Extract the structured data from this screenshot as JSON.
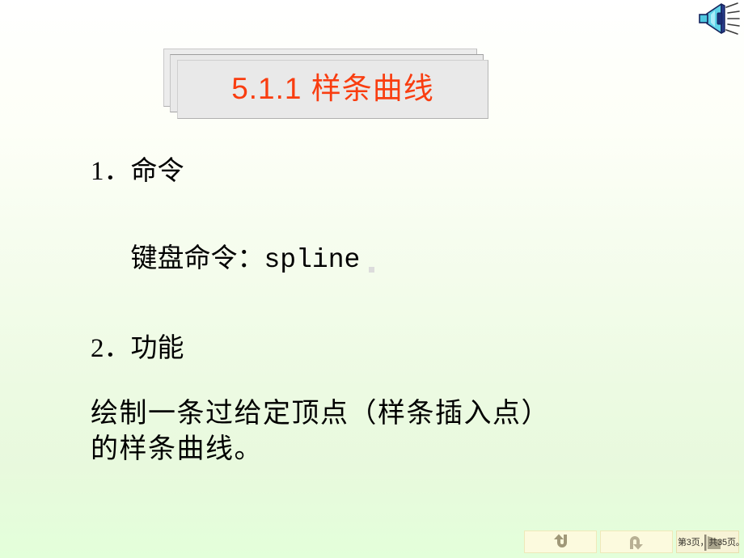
{
  "slide": {
    "title": "5.1.1  样条曲线",
    "title_color": "#f93d10",
    "background_top_color": "#ffffff",
    "background_bottom_color": "#e3ffda",
    "title_box_color": "#e9e9e9"
  },
  "content": {
    "command_heading": "1．命令",
    "keyboard_label": "键盘命令：",
    "keyboard_value": "spline",
    "function_heading": "2．功能",
    "description": "绘制一条过给定顶点（样条插入点）\n的样条曲线。"
  },
  "media": {
    "speaker_icon_name": "speaker-icon"
  },
  "nav": {
    "back_button_icon": "u-turn-up-arrow-icon",
    "forward_button_icon": "u-turn-down-arrow-icon",
    "page_indicator": "第3页，共35页。",
    "play_icon": "play-triangle-icon"
  }
}
